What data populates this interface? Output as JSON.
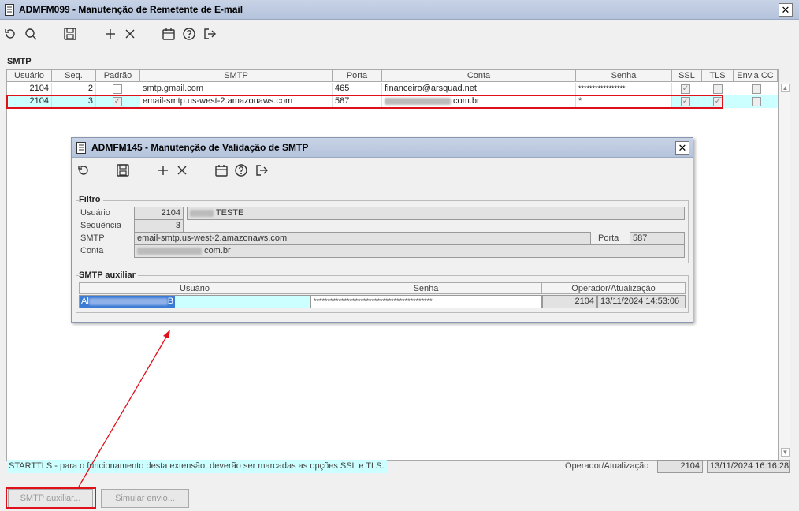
{
  "window": {
    "title": "ADMFM099 - Manutenção de Remetente de E-mail",
    "close_glyph": "✕"
  },
  "toolbar": {
    "icons": [
      "refresh-icon",
      "search-icon",
      "save-icon",
      "add-icon",
      "delete-icon",
      "calendar-icon",
      "help-icon",
      "exit-icon"
    ]
  },
  "smtp_group": {
    "label": "SMTP",
    "columns": [
      "Usuário",
      "Seq.",
      "Padrão",
      "SMTP",
      "Porta",
      "Conta",
      "Senha",
      "SSL",
      "TLS",
      "Envia CC"
    ],
    "rows": [
      {
        "usuario": "2104",
        "seq": "2",
        "padrao": false,
        "smtp": "smtp.gmail.com",
        "porta": "465",
        "conta": "financeiro@arsquad.net",
        "senha": "*****************",
        "ssl": true,
        "tls": false,
        "envia_cc": false
      },
      {
        "usuario": "2104",
        "seq": "3",
        "padrao": true,
        "smtp": "email-smtp.us-west-2.amazonaws.com",
        "porta": "587",
        "conta_suffix": ".com.br",
        "senha": "*",
        "ssl": true,
        "tls": true,
        "envia_cc": false
      }
    ]
  },
  "footer": {
    "hint": "STARTTLS - para o funcionamento desta extensão, deverão ser marcadas as opções SSL e TLS.",
    "operator_label": "Operador/Atualização",
    "operator_code": "2104",
    "operator_datetime": "13/11/2024 16:16:28",
    "smtp_aux_button": "SMTP auxiliar...",
    "simular_button": "Simular envio..."
  },
  "dialog": {
    "title": "ADMFM145 - Manutenção de Validação de SMTP",
    "close_glyph": "✕",
    "filtro": {
      "label": "Filtro",
      "usuario_label": "Usuário",
      "usuario_code": "2104",
      "usuario_name_suffix": "TESTE",
      "sequencia_label": "Sequência",
      "sequencia": "3",
      "smtp_label": "SMTP",
      "smtp": "email-smtp.us-west-2.amazonaws.com",
      "porta_label": "Porta",
      "porta": "587",
      "conta_label": "Conta",
      "conta_suffix": "com.br"
    },
    "aux": {
      "label": "SMTP auxiliar",
      "columns": [
        "Usuário",
        "Senha",
        "Operador/Atualização"
      ],
      "row": {
        "usuario_prefix": "Al",
        "usuario_suffix": "B",
        "senha": "*******************************************",
        "operador": "2104",
        "datetime": "13/11/2024 14:53:06"
      }
    }
  },
  "colors": {
    "title_bar": "#b4c3dc",
    "selection": "#ccffff",
    "highlight_red": "#e0101a"
  }
}
